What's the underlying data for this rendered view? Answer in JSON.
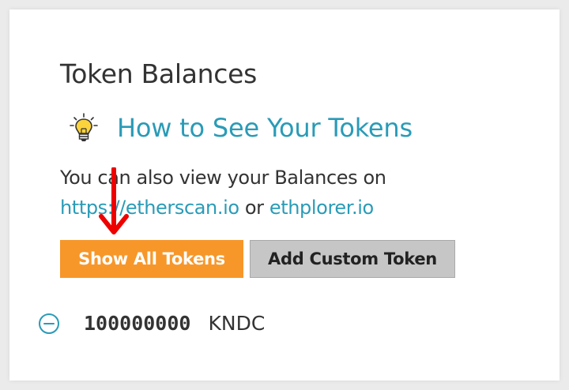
{
  "panel": {
    "title": "Token Balances"
  },
  "howto": {
    "link_label": "How to See Your Tokens"
  },
  "description": {
    "line1": "You can also view your Balances on",
    "link1": "https://etherscan.io",
    "between": " or ",
    "link2": "ethplorer.io"
  },
  "buttons": {
    "show_all": "Show All Tokens",
    "add_custom": "Add Custom Token"
  },
  "tokens": [
    {
      "amount": "100000000",
      "symbol": "KNDC"
    }
  ],
  "colors": {
    "accent_link": "#2a9bb7",
    "primary_button": "#f7972a",
    "secondary_button": "#c6c6c6",
    "annotation_arrow": "#ee0000"
  }
}
